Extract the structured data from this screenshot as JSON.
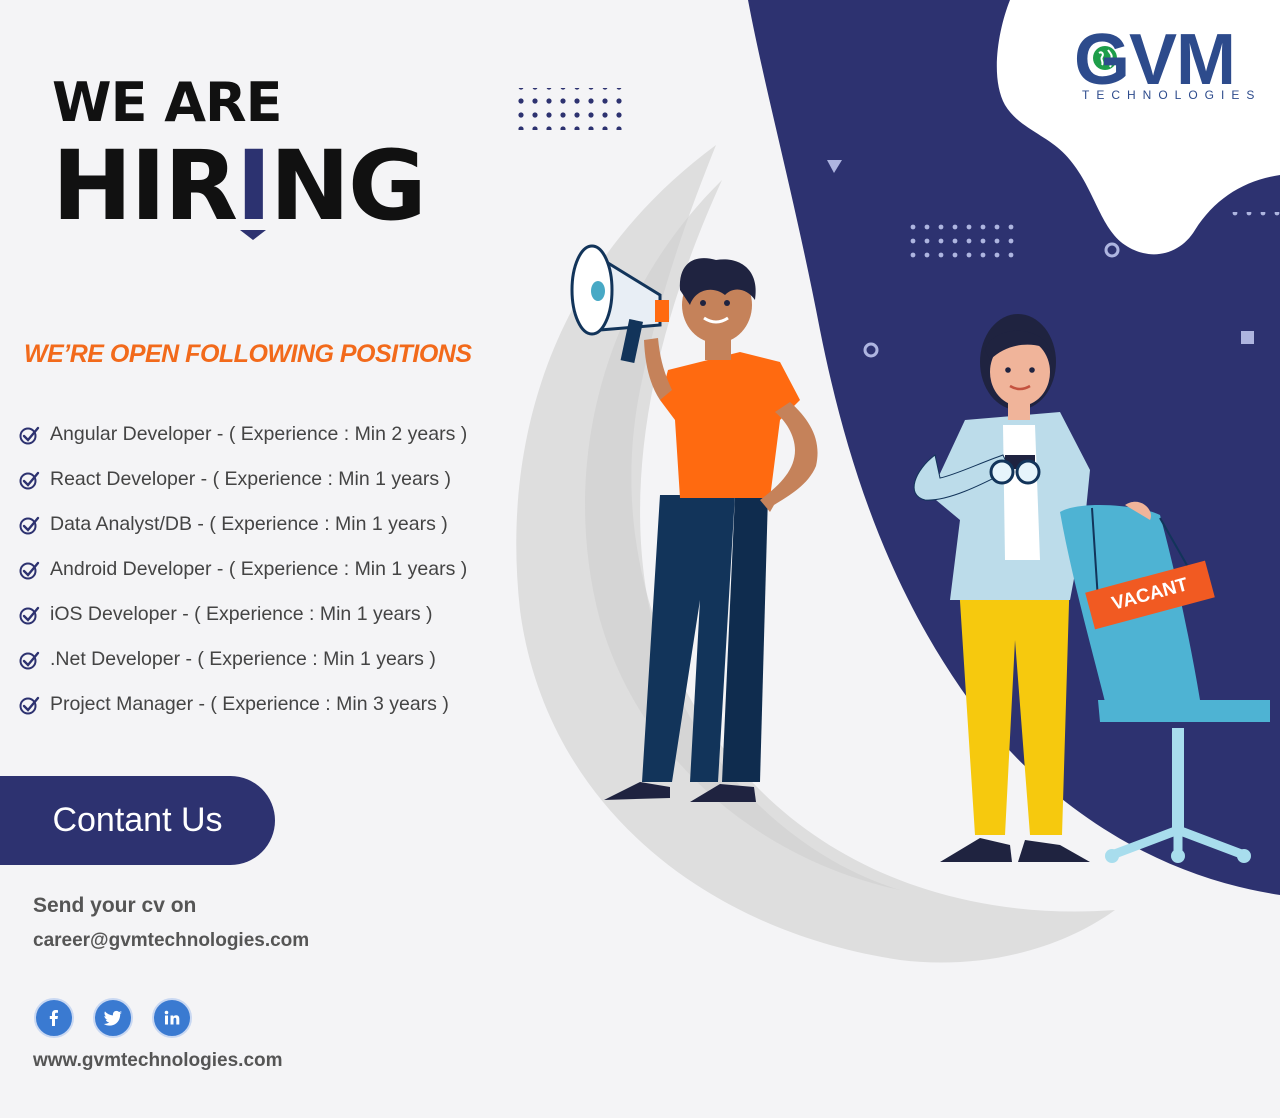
{
  "headline": {
    "line1": "WE ARE",
    "line2_before": "HIR",
    "line2_accent": "I",
    "line2_after": "NG"
  },
  "positions": {
    "heading": "WE’RE OPEN FOLLOWING POSITIONS",
    "items": [
      {
        "label": "Angular Developer - ( Experience : Min 2 years )",
        "icon": "check-circle-icon"
      },
      {
        "label": "React Developer - ( Experience : Min 1 years )",
        "icon": "check-circle-icon"
      },
      {
        "label": "Data Analyst/DB - ( Experience : Min 1 years )",
        "icon": "check-circle-icon"
      },
      {
        "label": "Android Developer - ( Experience : Min 1 years )",
        "icon": "check-circle-icon"
      },
      {
        "label": "iOS Developer - ( Experience : Min 1 years )",
        "icon": "check-circle-icon"
      },
      {
        "label": ".Net Developer - ( Experience : Min 1 years )",
        "icon": "check-circle-icon"
      },
      {
        "label": "Project Manager - ( Experience : Min 3 years )",
        "icon": "check-circle-icon"
      }
    ]
  },
  "contact": {
    "button_label": "Contant Us",
    "send_cv_label": "Send your cv on",
    "email": "career@gvmtechnologies.com",
    "website": "www.gvmtechnologies.com",
    "social": [
      {
        "icon": "facebook-icon"
      },
      {
        "icon": "twitter-icon"
      },
      {
        "icon": "linkedin-icon"
      }
    ]
  },
  "brand": {
    "name": "GVM",
    "subtitle": "TECHNOLOGIES"
  },
  "illustration": {
    "sign_text": "VACANT"
  },
  "colors": {
    "navy": "#2d3270",
    "orange_accent": "#f26a1b",
    "text_gray": "#444444",
    "background": "#f4f4f6"
  }
}
